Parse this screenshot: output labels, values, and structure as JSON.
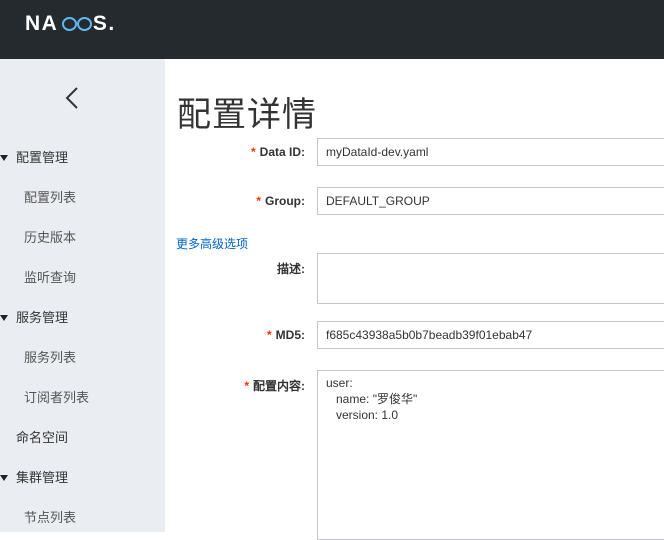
{
  "brand": {
    "logo_text": "NACOS.",
    "accent": "#5fb8ee"
  },
  "sidebar": {
    "collapse_icon": "chevron-left-icon",
    "groups": [
      {
        "label": "配置管理",
        "items": [
          "配置列表",
          "历史版本",
          "监听查询"
        ]
      },
      {
        "label": "服务管理",
        "items": [
          "服务列表",
          "订阅者列表"
        ]
      }
    ],
    "namespace": "命名空间",
    "cluster": {
      "label": "集群管理",
      "items": [
        "节点列表"
      ]
    }
  },
  "page": {
    "title": "配置详情",
    "fields": {
      "data_id": {
        "label": "Data ID:",
        "value": "myDataId-dev.yaml",
        "required": true
      },
      "group": {
        "label": "Group:",
        "value": "DEFAULT_GROUP",
        "required": true
      },
      "advanced_link": "更多高级选项",
      "description": {
        "label": "描述:",
        "value": ""
      },
      "md5": {
        "label": "MD5:",
        "value": "f685c43938a5b0b7beadb39f01ebab47",
        "required": true
      },
      "content": {
        "label": "配置内容:",
        "value": "user:\n   name: \"罗俊华\"\n   version: 1.0",
        "required": true
      }
    },
    "required_mark": "*"
  }
}
